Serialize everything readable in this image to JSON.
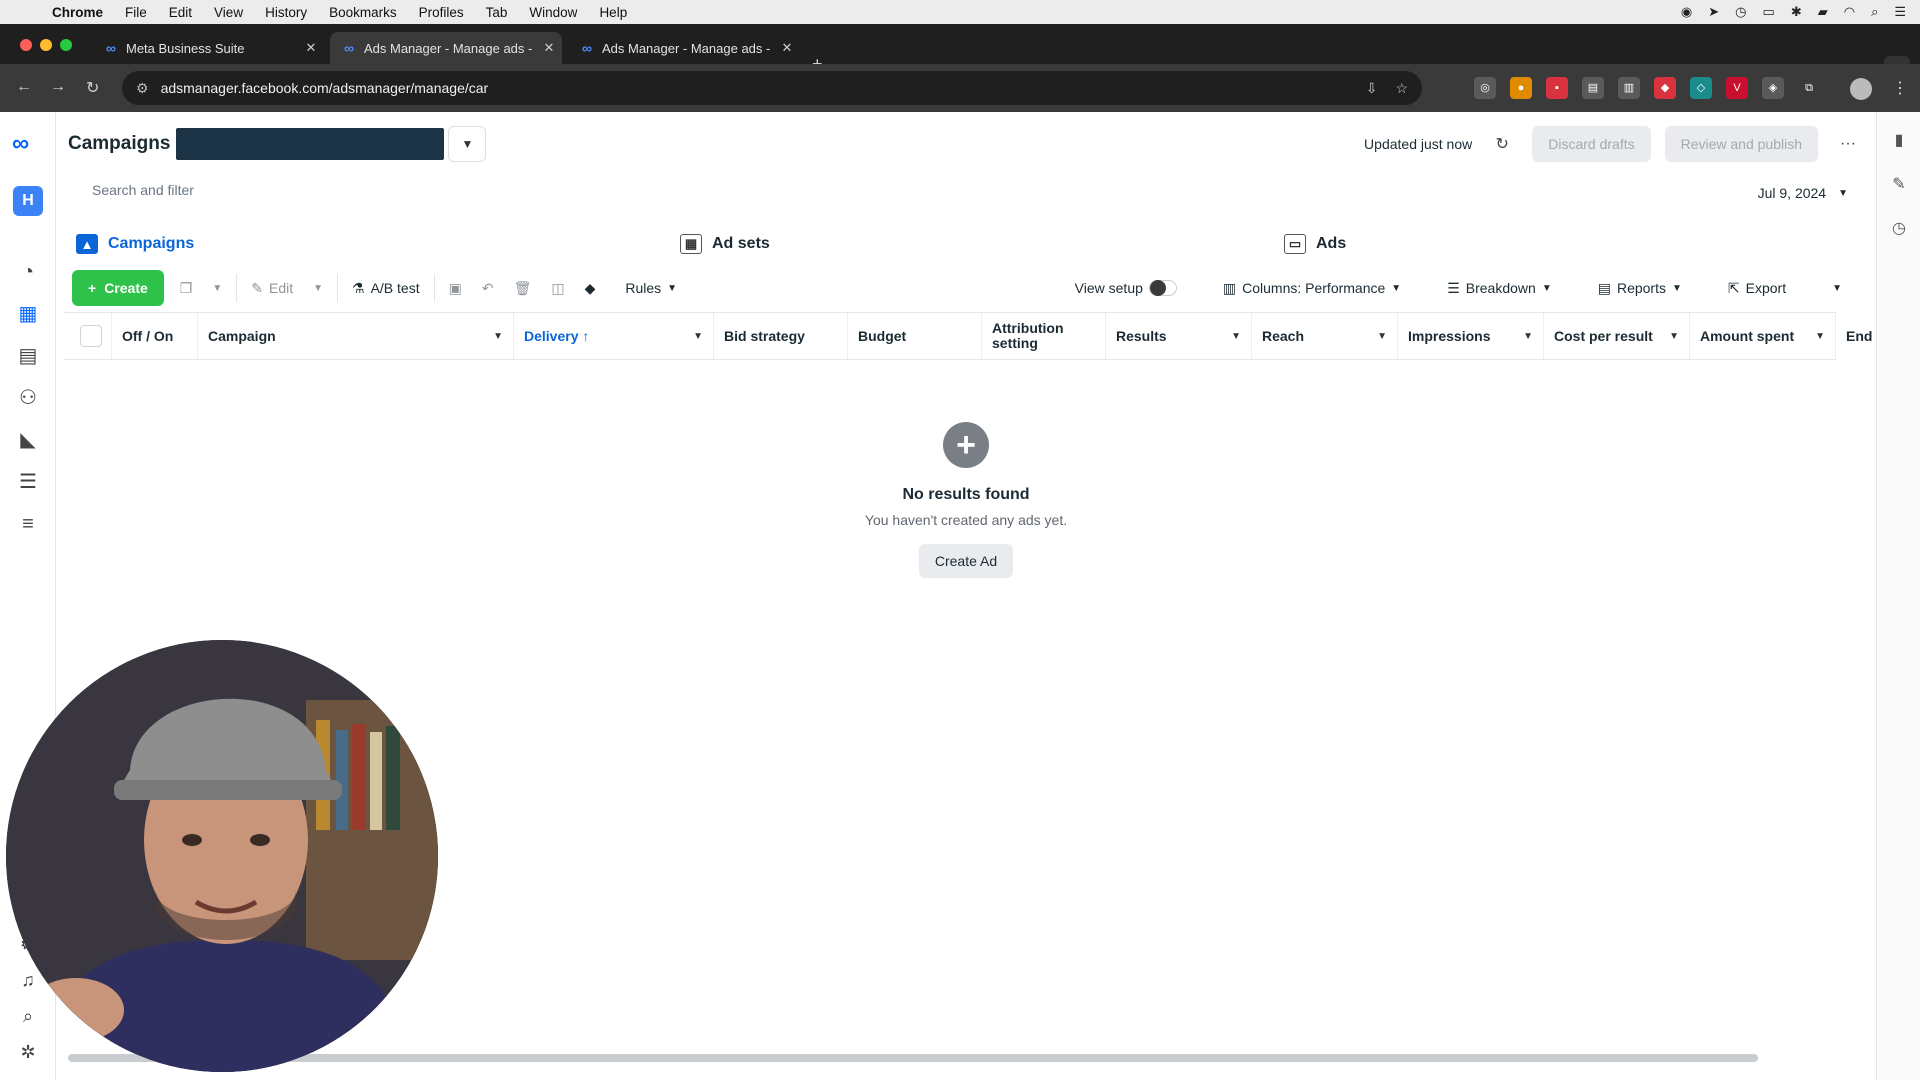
{
  "menubar": {
    "apple_icon": "apple-icon",
    "app": "Chrome",
    "items": [
      "File",
      "Edit",
      "View",
      "History",
      "Bookmarks",
      "Profiles",
      "Tab",
      "Window",
      "Help"
    ]
  },
  "tabs": [
    {
      "label": "Meta Business Suite",
      "close": "✕",
      "active": false
    },
    {
      "label": "Ads Manager - Manage ads -",
      "close": "✕",
      "active": true
    },
    {
      "label": "Ads Manager - Manage ads -",
      "close": "✕",
      "active": false
    }
  ],
  "new_tab": "+",
  "address": {
    "url": "adsmanager.facebook.com/adsmanager/manage/car"
  },
  "header": {
    "title": "Campaigns",
    "updated": "Updated just now",
    "discard": "Discard drafts",
    "review": "Review and publish",
    "more": "···"
  },
  "search": {
    "placeholder": "Search and filter"
  },
  "date": {
    "label": "Jul 9, 2024"
  },
  "levels": {
    "campaigns": "Campaigns",
    "adsets": "Ad sets",
    "ads": "Ads"
  },
  "toolbar": {
    "create": "Create",
    "edit": "Edit",
    "abtest": "A/B test",
    "rules": "Rules",
    "view_setup": "View setup",
    "columns": "Columns: Performance",
    "breakdown": "Breakdown",
    "reports": "Reports",
    "export": "Export"
  },
  "table": {
    "headers": {
      "offon": "Off / On",
      "campaign": "Campaign",
      "delivery": "Delivery ↑",
      "bid": "Bid strategy",
      "budget": "Budget",
      "attribution": "Attribution setting",
      "results": "Results",
      "reach": "Reach",
      "impressions": "Impressions",
      "cpr": "Cost per result",
      "spent": "Amount spent",
      "ends": "End"
    }
  },
  "empty": {
    "title": "No results found",
    "subtitle": "You haven't created any ads yet.",
    "button": "Create Ad"
  },
  "colors": {
    "brand_blue": "#0866ff",
    "create_green": "#2fc24a",
    "active_blue": "#0a66d8"
  }
}
